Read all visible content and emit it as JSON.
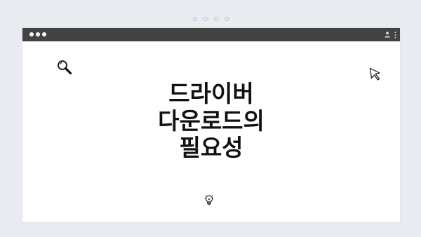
{
  "page": {
    "title_lines": [
      "드라이버",
      "다운로드의",
      "필요성"
    ]
  },
  "icons": {
    "window_controls": "traffic-light-dots",
    "account": "user-icon",
    "menu": "kebab-menu-icon",
    "search": "magnifying-glass-icon",
    "pointer": "cursor-arrow-icon",
    "idea": "light-bulb-icon"
  },
  "colors": {
    "background": "#e8ecf1",
    "titlebar": "#434343",
    "window": "#ffffff",
    "title_text": "#111111"
  }
}
